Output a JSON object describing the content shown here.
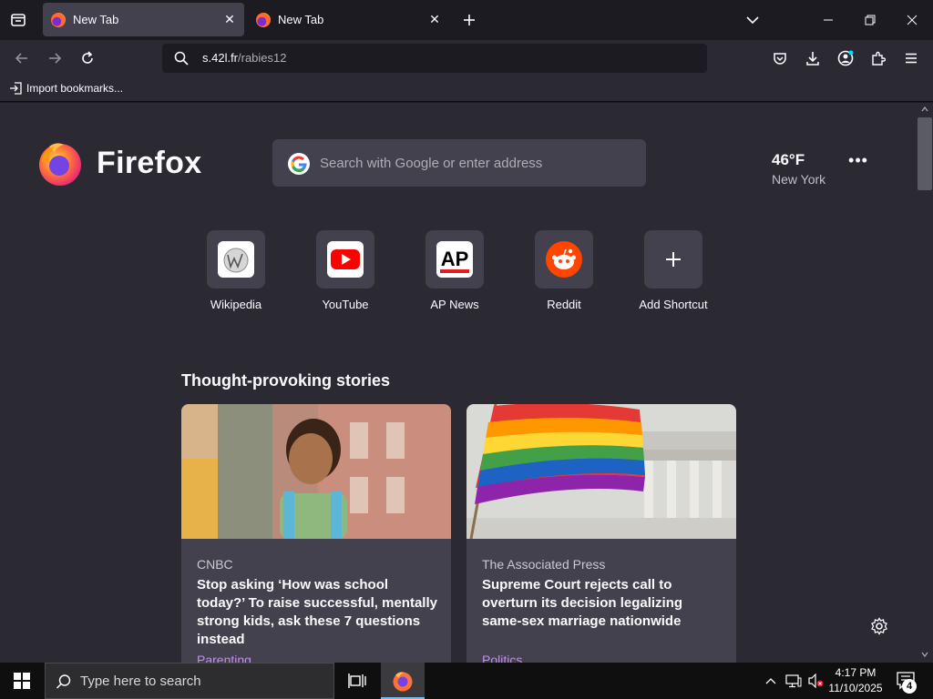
{
  "tabs": [
    {
      "title": "New Tab",
      "active": true
    },
    {
      "title": "New Tab",
      "active": false
    }
  ],
  "toolbar": {
    "url_host": "s.42l.fr",
    "url_path": "/rabies12"
  },
  "bookmarks": {
    "import_label": "Import bookmarks..."
  },
  "newtab": {
    "brand": "Firefox",
    "search_placeholder": "Search with Google or enter address",
    "weather": {
      "temp": "46°F",
      "city": "New York"
    },
    "shortcuts": [
      {
        "label": "Wikipedia",
        "icon": "wikipedia-icon"
      },
      {
        "label": "YouTube",
        "icon": "youtube-icon"
      },
      {
        "label": "AP News",
        "icon": "ap-news-icon"
      },
      {
        "label": "Reddit",
        "icon": "reddit-icon"
      },
      {
        "label": "Add Shortcut",
        "icon": "plus-icon"
      }
    ],
    "section_title": "Thought-provoking stories",
    "stories": [
      {
        "publisher": "CNBC",
        "headline": "Stop asking ‘How was school today?’ To raise successful, mentally strong kids, ask these 7 questions instead",
        "category": "Parenting"
      },
      {
        "publisher": "The Associated Press",
        "headline": "Supreme Court rejects call to overturn its decision legalizing same-sex marriage nationwide",
        "category": "Politics"
      }
    ]
  },
  "taskbar": {
    "search_placeholder": "Type here to search",
    "time": "4:17 PM",
    "date": "11/10/2025",
    "notification_count": "4"
  },
  "colors": {
    "accent_purple": "#c58cf6",
    "toolbar_bg": "#2b2a33",
    "tab_active_bg": "#42414d"
  }
}
